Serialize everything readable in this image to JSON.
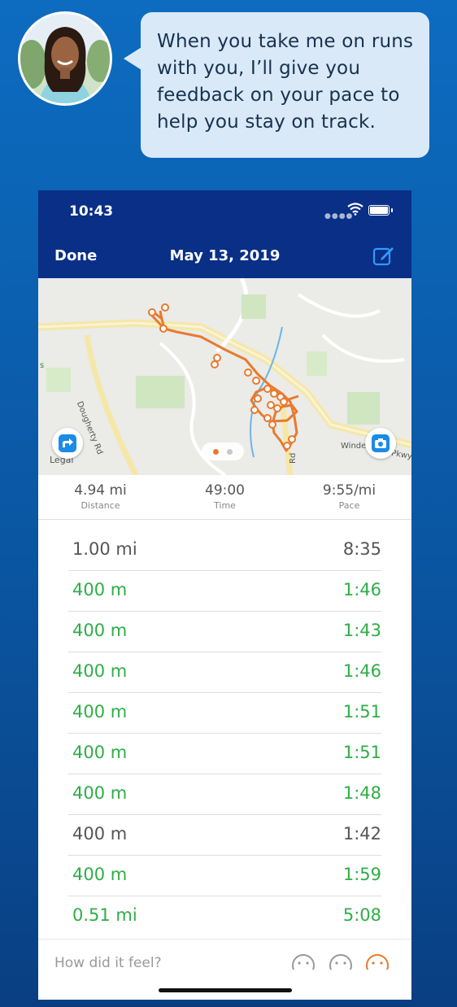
{
  "coach": {
    "message": "When you take me on runs with you, I’ll give you feedback on your pace to help you stay on track."
  },
  "status_bar": {
    "time": "10:43",
    "signal_icon": "signal-dots-icon",
    "wifi_icon": "wifi-icon",
    "battery_icon": "battery-icon"
  },
  "nav": {
    "done_label": "Done",
    "title": "May 13, 2019",
    "edit_icon": "edit-icon"
  },
  "map": {
    "legal_label": "Legal",
    "road_labels": [
      "Dougherty Rd",
      "Rd",
      "Windem",
      "Pkwy",
      "s"
    ],
    "route_color": "#e87a2e"
  },
  "stats": [
    {
      "value": "4.94 mi",
      "label": "Distance"
    },
    {
      "value": "49:00",
      "label": "Time"
    },
    {
      "value": "9:55/mi",
      "label": "Pace"
    }
  ],
  "splits": [
    {
      "distance": "1.00 mi",
      "time": "8:35",
      "status": "gray"
    },
    {
      "distance": "400 m",
      "time": "1:46",
      "status": "green"
    },
    {
      "distance": "400 m",
      "time": "1:43",
      "status": "green"
    },
    {
      "distance": "400 m",
      "time": "1:46",
      "status": "green"
    },
    {
      "distance": "400 m",
      "time": "1:51",
      "status": "green"
    },
    {
      "distance": "400 m",
      "time": "1:51",
      "status": "green"
    },
    {
      "distance": "400 m",
      "time": "1:48",
      "status": "green"
    },
    {
      "distance": "400 m",
      "time": "1:42",
      "status": "gray"
    },
    {
      "distance": "400 m",
      "time": "1:59",
      "status": "green"
    },
    {
      "distance": "0.51 mi",
      "time": "5:08",
      "status": "green"
    }
  ],
  "feel": {
    "prompt": "How did it feel?"
  },
  "colors": {
    "brand_navy": "#092f86",
    "good_pace": "#2eae47",
    "neutral_pace": "#555555",
    "accent_orange": "#e87a2e",
    "accent_blue": "#1a8be6"
  }
}
